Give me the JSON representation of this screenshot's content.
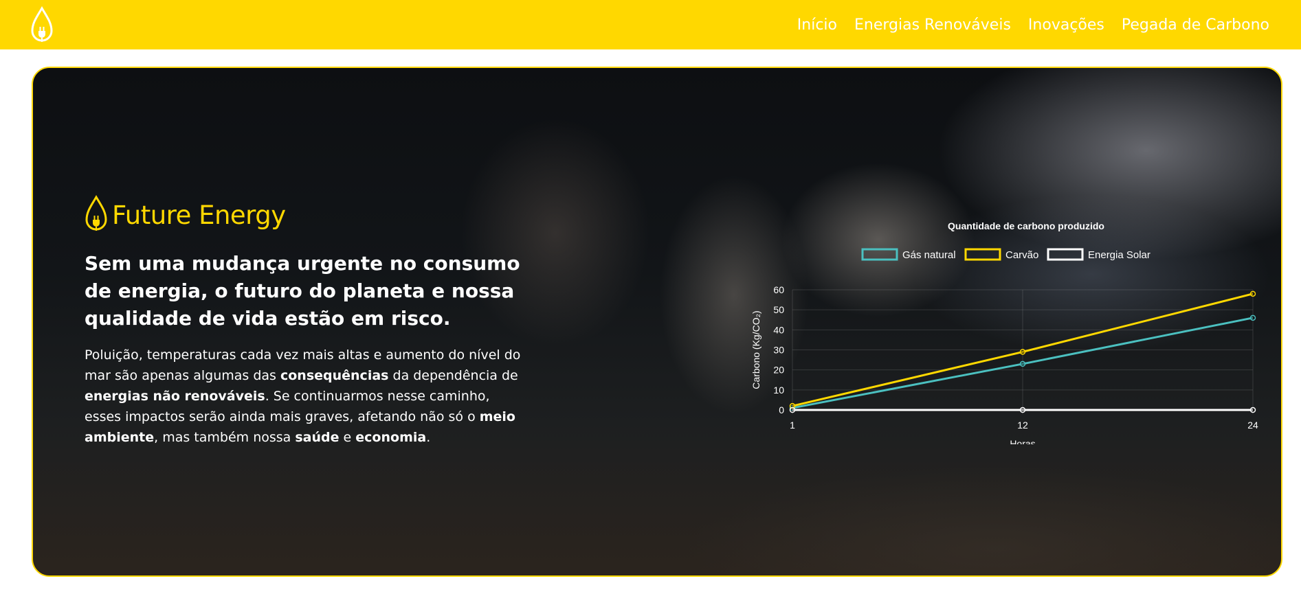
{
  "nav": {
    "logo_icon": "drop-plug-icon",
    "links": [
      "Início",
      "Energias Renováveis",
      "Inovações",
      "Pegada de Carbono"
    ]
  },
  "hero": {
    "brand_icon": "drop-plug-icon",
    "brand_title": "Future Energy",
    "headline": [
      {
        "text": "Sem uma mudança urgente no consumo de ",
        "bold": false
      },
      {
        "text": "energia",
        "bold": true
      },
      {
        "text": ", o futuro do planeta e nossa qualidade de vida estão em ",
        "bold": false
      },
      {
        "text": "risco",
        "bold": true
      },
      {
        "text": ".",
        "bold": false
      }
    ],
    "paragraph": [
      {
        "text": "Poluição, temperaturas cada vez mais altas e aumento do nível do mar são apenas algumas das ",
        "bold": false
      },
      {
        "text": "consequências",
        "bold": true
      },
      {
        "text": " da dependência de ",
        "bold": false
      },
      {
        "text": "energias não renováveis",
        "bold": true
      },
      {
        "text": ". Se continuarmos nesse caminho, esses impactos serão ainda mais graves, afetando não só o ",
        "bold": false
      },
      {
        "text": "meio ambiente",
        "bold": true
      },
      {
        "text": ", mas também nossa ",
        "bold": false
      },
      {
        "text": "saúde",
        "bold": true
      },
      {
        "text": " e ",
        "bold": false
      },
      {
        "text": "economia",
        "bold": true
      },
      {
        "text": ".",
        "bold": false
      }
    ]
  },
  "colors": {
    "brand_yellow": "#ffd800",
    "gas": "#4bc0c0",
    "coal": "#ffd800",
    "solar": "#ffffff"
  },
  "chart_data": {
    "type": "line",
    "title": "Quantidade de carbono produzido",
    "xlabel": "Horas",
    "ylabel": "Carbono (Kg/CO₂)",
    "x": [
      "1",
      "12",
      "24"
    ],
    "ylim": [
      0,
      60
    ],
    "yticks": [
      "0",
      "10",
      "20",
      "30",
      "40",
      "50",
      "60"
    ],
    "legend_position": "top",
    "grid": true,
    "series": [
      {
        "name": "Gás natural",
        "color": "#4bc0c0",
        "values": [
          1,
          23,
          46
        ]
      },
      {
        "name": "Carvão",
        "color": "#ffd800",
        "values": [
          2,
          29,
          58
        ]
      },
      {
        "name": "Energia Solar",
        "color": "#ffffff",
        "values": [
          0,
          0,
          0
        ]
      }
    ]
  }
}
